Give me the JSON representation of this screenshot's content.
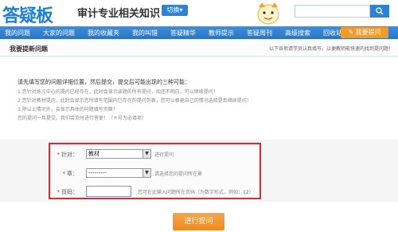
{
  "header": {
    "logo": "答疑板",
    "site_title": "审计专业相关知识",
    "switch_label": "切换▾"
  },
  "nav": {
    "items": [
      "我的问题",
      "大家的问题",
      "我的收藏夹",
      "我的叫错",
      "答疑精华",
      "教师提示",
      "答疑周刊",
      "高级搜索",
      "回收站"
    ],
    "ask_label": "我要提问"
  },
  "section": {
    "title": "我要提新问题",
    "note": "以下各项请学员认真填写，以便教师能快速的找到提问题！"
  },
  "intro": {
    "heading": "请先填写您的问题详细位置，然后提交，提交后可能出现的三种可能：",
    "lines": [
      "1.您针对练习中心的提问已经存在，此时会显示该题的所有提问，如还不明白，可以继续提问！",
      "2.您针对教材提问，此时会显示您所填写范围内已存在的提问列表，您可以根据自己的情况选择是否继续提问！",
      "3.除以上情况外，会显示具体的问题填写页面！",
      "您的提问一旦提交，我们会及时进行答复！（＊号为必填项）"
    ]
  },
  "form": {
    "target": {
      "label": "针对：",
      "value": "教材",
      "hint": "进行提问"
    },
    "chapter": {
      "label": "章：",
      "value": "---------",
      "hint": "请选择您的提问所在章"
    },
    "page": {
      "label": "页码：",
      "value": "",
      "hint": "您可在此输入问题所在页码（为数字形式，例如：",
      "hint_example": "12",
      "hint_end": "）"
    }
  },
  "submit_label": "进行提问"
}
